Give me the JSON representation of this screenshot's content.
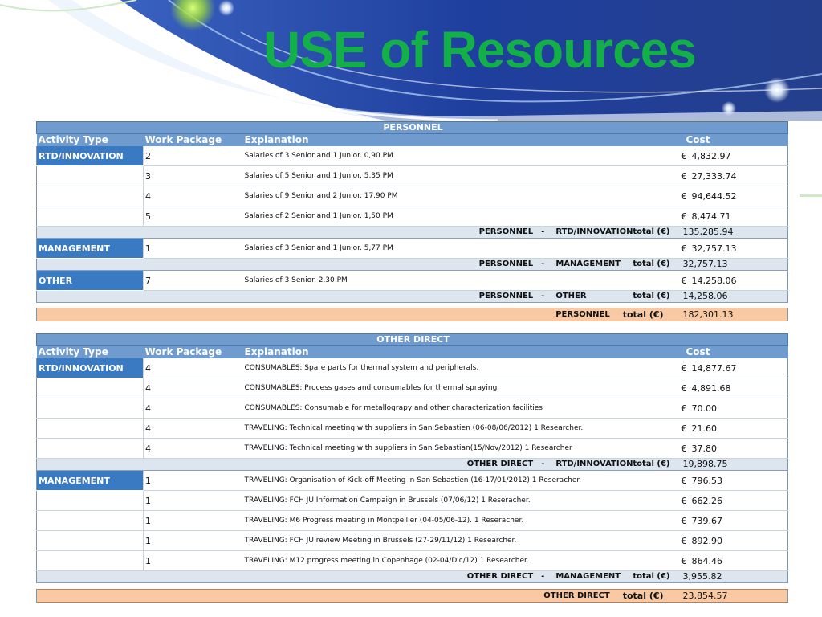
{
  "title": "USE of Resources",
  "currency_symbol": "€",
  "columns": {
    "activity_type": "Activity Type",
    "work_package": "Work Package",
    "explanation": "Explanation",
    "cost": "Cost"
  },
  "personnel": {
    "section_title": "PERSONNEL",
    "groups": [
      {
        "activity": "RTD/INNOVATION",
        "rows": [
          {
            "wp": "2",
            "explanation": "Salaries of 3 Senior and 1 Junior. 0,90 PM",
            "cost": "4,832.97"
          },
          {
            "wp": "3",
            "explanation": "Salaries of 5 Senior and 1 Junior. 5,35 PM",
            "cost": "27,333.74"
          },
          {
            "wp": "4",
            "explanation": "Salaries of 9 Senior and 2 Junior. 17,90 PM",
            "cost": "94,644.52"
          },
          {
            "wp": "5",
            "explanation": "Salaries of 2 Senior and 1 Junior. 1,50 PM",
            "cost": "8,474.71"
          }
        ],
        "subtotal": {
          "group": "PERSONNEL",
          "sep": "-",
          "activity": "RTD/INNOVATION",
          "total_label": "total (€)",
          "value": "135,285.94"
        }
      },
      {
        "activity": "MANAGEMENT",
        "rows": [
          {
            "wp": "1",
            "explanation": "Salaries of 3 Senior and 1 Junior. 5,77 PM",
            "cost": "32,757.13"
          }
        ],
        "subtotal": {
          "group": "PERSONNEL",
          "sep": "-",
          "activity": "MANAGEMENT",
          "total_label": "total (€)",
          "value": "32,757.13"
        }
      },
      {
        "activity": "OTHER",
        "rows": [
          {
            "wp": "7",
            "explanation": "Salaries of 3 Senior. 2,30 PM",
            "cost": "14,258.06"
          }
        ],
        "subtotal": {
          "group": "PERSONNEL",
          "sep": "-",
          "activity": "OTHER",
          "total_label": "total (€)",
          "value": "14,258.06"
        }
      }
    ],
    "total": {
      "group": "PERSONNEL",
      "total_label": "total (€)",
      "value": "182,301.13"
    }
  },
  "other_direct": {
    "section_title": "OTHER DIRECT",
    "groups": [
      {
        "activity": "RTD/INNOVATION",
        "rows": [
          {
            "wp": "4",
            "explanation": "CONSUMABLES: Spare parts for thermal system and peripherals.",
            "cost": "14,877.67"
          },
          {
            "wp": "4",
            "explanation": "CONSUMABLES: Process gases and consumables for thermal spraying",
            "cost": "4,891.68"
          },
          {
            "wp": "4",
            "explanation": "CONSUMABLES: Consumable for metallograpy and other characterization facilities",
            "cost": "70.00"
          },
          {
            "wp": "4",
            "explanation": "TRAVELING: Technical meeting with suppliers in San Sebastien (06-08/06/2012) 1 Researcher.",
            "cost": "21.60"
          },
          {
            "wp": "4",
            "explanation": "TRAVELING: Technical meeting with suppliers  in San Sebastian(15/Nov/2012) 1 Researcher",
            "cost": "37.80"
          }
        ],
        "subtotal": {
          "group": "OTHER DIRECT",
          "sep": "-",
          "activity": "RTD/INNOVATION",
          "total_label": "total (€)",
          "value": "19,898.75"
        }
      },
      {
        "activity": "MANAGEMENT",
        "rows": [
          {
            "wp": "1",
            "explanation": "TRAVELING: Organisation of Kick-off Meeting in San Sebastien (16-17/01/2012) 1 Reseracher.",
            "cost": "796.53"
          },
          {
            "wp": "1",
            "explanation": "TRAVELING: FCH JU Information Campaign in Brussels (07/06/12) 1 Reseracher.",
            "cost": "662.26"
          },
          {
            "wp": "1",
            "explanation": "TRAVELING: M6 Progress meeting in Montpellier (04-05/06-12). 1 Reseracher.",
            "cost": "739.67"
          },
          {
            "wp": "1",
            "explanation": "TRAVELING: FCH JU review Meeting in Brussels (27-29/11/12) 1 Researcher.",
            "cost": "892.90"
          },
          {
            "wp": "1",
            "explanation": "TRAVELING: M12 progress meeting in Copenhage (02-04/Dic/12) 1 Researcher.",
            "cost": "864.46"
          }
        ],
        "subtotal": {
          "group": "OTHER DIRECT",
          "sep": "-",
          "activity": "MANAGEMENT",
          "total_label": "total (€)",
          "value": "3,955.82"
        }
      }
    ],
    "total": {
      "group": "OTHER DIRECT",
      "total_label": "total (€)",
      "value": "23,854.57"
    }
  },
  "colors": {
    "title_green": "#13b04a",
    "banner_blue": "#1f3f9e",
    "header_blue": "#6f9bcf",
    "activity_blue": "#3a7ac2",
    "subtotal_bg": "#dde5ee",
    "total_bg": "#f8c9a3"
  }
}
